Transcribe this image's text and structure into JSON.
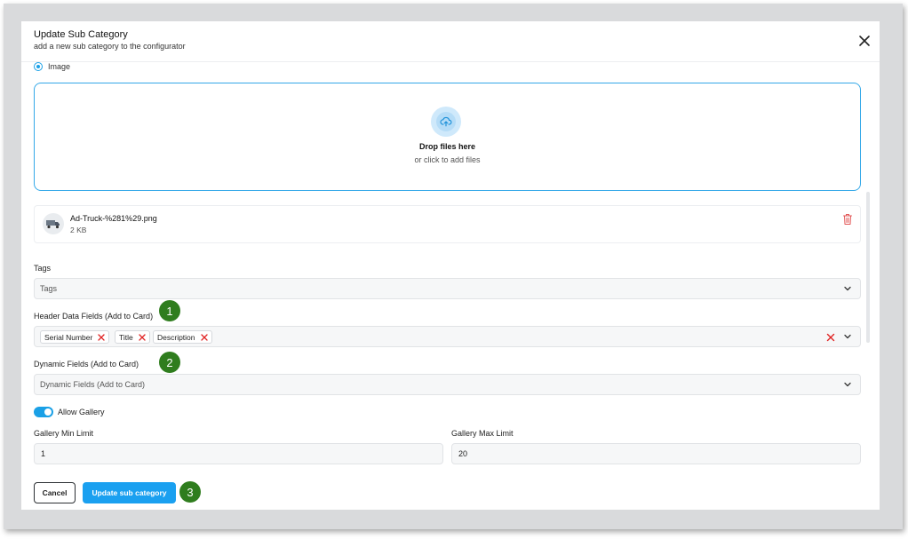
{
  "modal": {
    "title": "Update Sub Category",
    "subtitle": "add a new sub category to the configurator"
  },
  "media": {
    "radio_label": "Image",
    "dropzone_title": "Drop files here",
    "dropzone_subtitle": "or click to add files",
    "file": {
      "name": "Ad-Truck-%281%29.png",
      "size": "2 KB"
    }
  },
  "tags": {
    "label": "Tags",
    "placeholder": "Tags"
  },
  "header_fields": {
    "label": "Header Data Fields (Add to Card)",
    "chips": [
      "Serial Number",
      "Title",
      "Description"
    ]
  },
  "dynamic_fields": {
    "label": "Dynamic Fields (Add to Card)",
    "placeholder": "Dynamic Fields (Add to Card)"
  },
  "gallery": {
    "toggle_label": "Allow Gallery",
    "toggle_on": true,
    "min_label": "Gallery Min Limit",
    "min_value": "1",
    "max_label": "Gallery Max Limit",
    "max_value": "20"
  },
  "footer": {
    "cancel_label": "Cancel",
    "submit_label": "Update sub category"
  },
  "annotations": [
    "1",
    "2",
    "3"
  ],
  "colors": {
    "accent": "#1aa0f0",
    "badge": "#2f7d1e",
    "remove_x": "#e02424"
  }
}
